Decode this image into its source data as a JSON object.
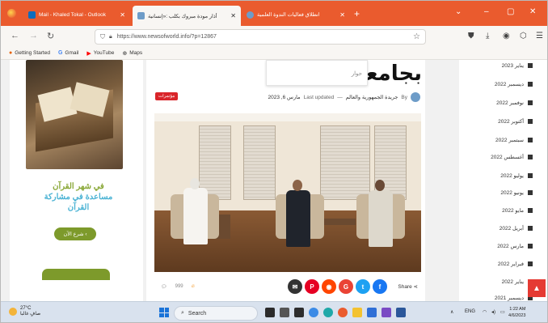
{
  "browser": {
    "tabs": [
      {
        "title": "Mail - Khaled Tokal - Outlook",
        "active": false
      },
      {
        "title": "أذار مودة مبروك بكلب :«إنسانية",
        "active": true
      },
      {
        "title": "انطلاق فعاليات الندوة العلمية",
        "active": false
      }
    ],
    "window_controls": {
      "minimize": "–",
      "maximize": "▢",
      "close": "✕",
      "menu": "⌄"
    },
    "url": "https://www.newsofworld.info/?p=12867",
    "bookmarks": [
      {
        "label": "Getting Started",
        "icon": "firefox-icon"
      },
      {
        "label": "Gmail",
        "icon": "google-icon"
      },
      {
        "label": "YouTube",
        "icon": "youtube-icon"
      },
      {
        "label": "Maps",
        "icon": "globe-icon"
      }
    ]
  },
  "left_sidebar": {
    "promo_line1": "في شهر القرآن",
    "promo_line2": "مساعدة في مشاركة",
    "promo_line3": "القرآن",
    "promo_button": "شرع الآن"
  },
  "article": {
    "headline": "بجامعة",
    "search_popup": "حوار",
    "badge": "مؤتمرات",
    "author": "جريدة الجمهورية والعالم",
    "by_label": "By",
    "last_updated": "Last updated",
    "date": "مارس 6, 2023",
    "share_label": "Share",
    "stat_views": "999"
  },
  "archive": {
    "items": [
      "يناير 2023",
      "ديسمبر 2022",
      "نوفمبر 2022",
      "أكتوبر 2022",
      "سبتمبر 2022",
      "أغسطس 2022",
      "يوليو 2022",
      "يونيو 2022",
      "مايو 2022",
      "أبريل 2022",
      "مارس 2022",
      "فبراير 2022",
      "يناير 2022",
      "ديسمبر 2021"
    ]
  },
  "taskbar": {
    "temperature": "27°C",
    "weather_text": "صافٍ غالبا",
    "search_label": "Search",
    "language": "ENG",
    "time": "1:22 AM",
    "date": "4/6/2023"
  },
  "colors": {
    "tab_bar": "#ea5b2e",
    "accent_red": "#d9252a",
    "promo_green": "#7d9a2b",
    "promo_blue": "#4bb3d4"
  }
}
